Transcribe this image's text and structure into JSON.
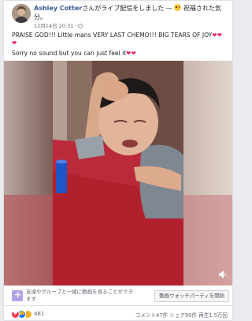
{
  "header": {
    "author": "Ashley Cotter",
    "action_text": "さんがライブ配信をしました — ",
    "feeling_text": "祝福された気分。",
    "timestamp": "12月14日 20:31 ·"
  },
  "post": {
    "line1": "PRAISE GOD!!! Little mans VERY LAST CHEMO!!! BIG TEARS OF JOY",
    "line2": "Sorry no sound but you can just feel it"
  },
  "watch_party": {
    "description": "友達やグループと一緒に動画を見ることができます",
    "button_label": "動画ウォッチパーティを開始"
  },
  "footer": {
    "reaction_count": "481",
    "comments": "コメント47件",
    "shares": "シェア90件",
    "views": "再生1.5万回"
  },
  "colors": {
    "accent": "#385898",
    "heart": "#e0245e",
    "like": "#1877f2",
    "party_icon": "#b4a3e4"
  },
  "icons": [
    "globe-icon",
    "volume-icon",
    "watch-party-icon",
    "love-reaction-icon",
    "like-reaction-icon",
    "sad-reaction-icon"
  ]
}
